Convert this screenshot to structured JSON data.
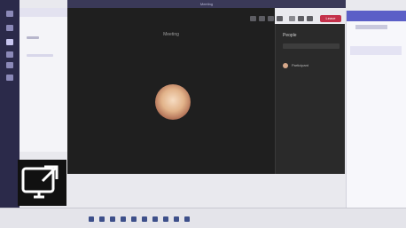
{
  "window": {
    "title": "Meeting"
  },
  "meeting": {
    "call_name": "Meeting",
    "leave_label": "Leave"
  },
  "participants": {
    "header": "People",
    "name": "Participant"
  },
  "icons": {
    "share": "share-screen-icon",
    "rail": [
      "activity-icon",
      "chat-icon",
      "teams-icon",
      "calendar-icon",
      "calls-icon",
      "files-icon"
    ],
    "toolbar": [
      "camera-icon",
      "mic-icon",
      "share-icon",
      "more-icon",
      "participants-icon",
      "chat-icon"
    ]
  },
  "colors": {
    "rail": "#2b2a4a",
    "leave": "#c4314b",
    "accent": "#5b5fc7"
  }
}
